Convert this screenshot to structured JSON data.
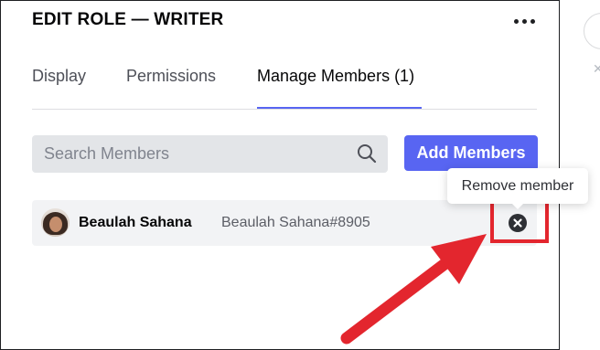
{
  "header": {
    "title": "EDIT ROLE — WRITER",
    "more_icon": "more-horizontal-icon"
  },
  "tabs": [
    {
      "label": "Display",
      "active": false
    },
    {
      "label": "Permissions",
      "active": false
    },
    {
      "label": "Manage Members (1)",
      "active": true
    }
  ],
  "search": {
    "placeholder": "Search Members",
    "value": "",
    "icon": "search-icon"
  },
  "add_members_label": "Add Members",
  "members": [
    {
      "name": "Beaulah Sahana",
      "tag": "Beaulah Sahana#8905",
      "remove_icon": "close-circle-icon"
    }
  ],
  "tooltip": {
    "text": "Remove member"
  },
  "annotation": {
    "color": "#e3262e"
  },
  "colors": {
    "accent": "#5865f2",
    "search_bg": "#e3e5e8",
    "row_bg": "#f2f3f5",
    "text": "#060607"
  }
}
